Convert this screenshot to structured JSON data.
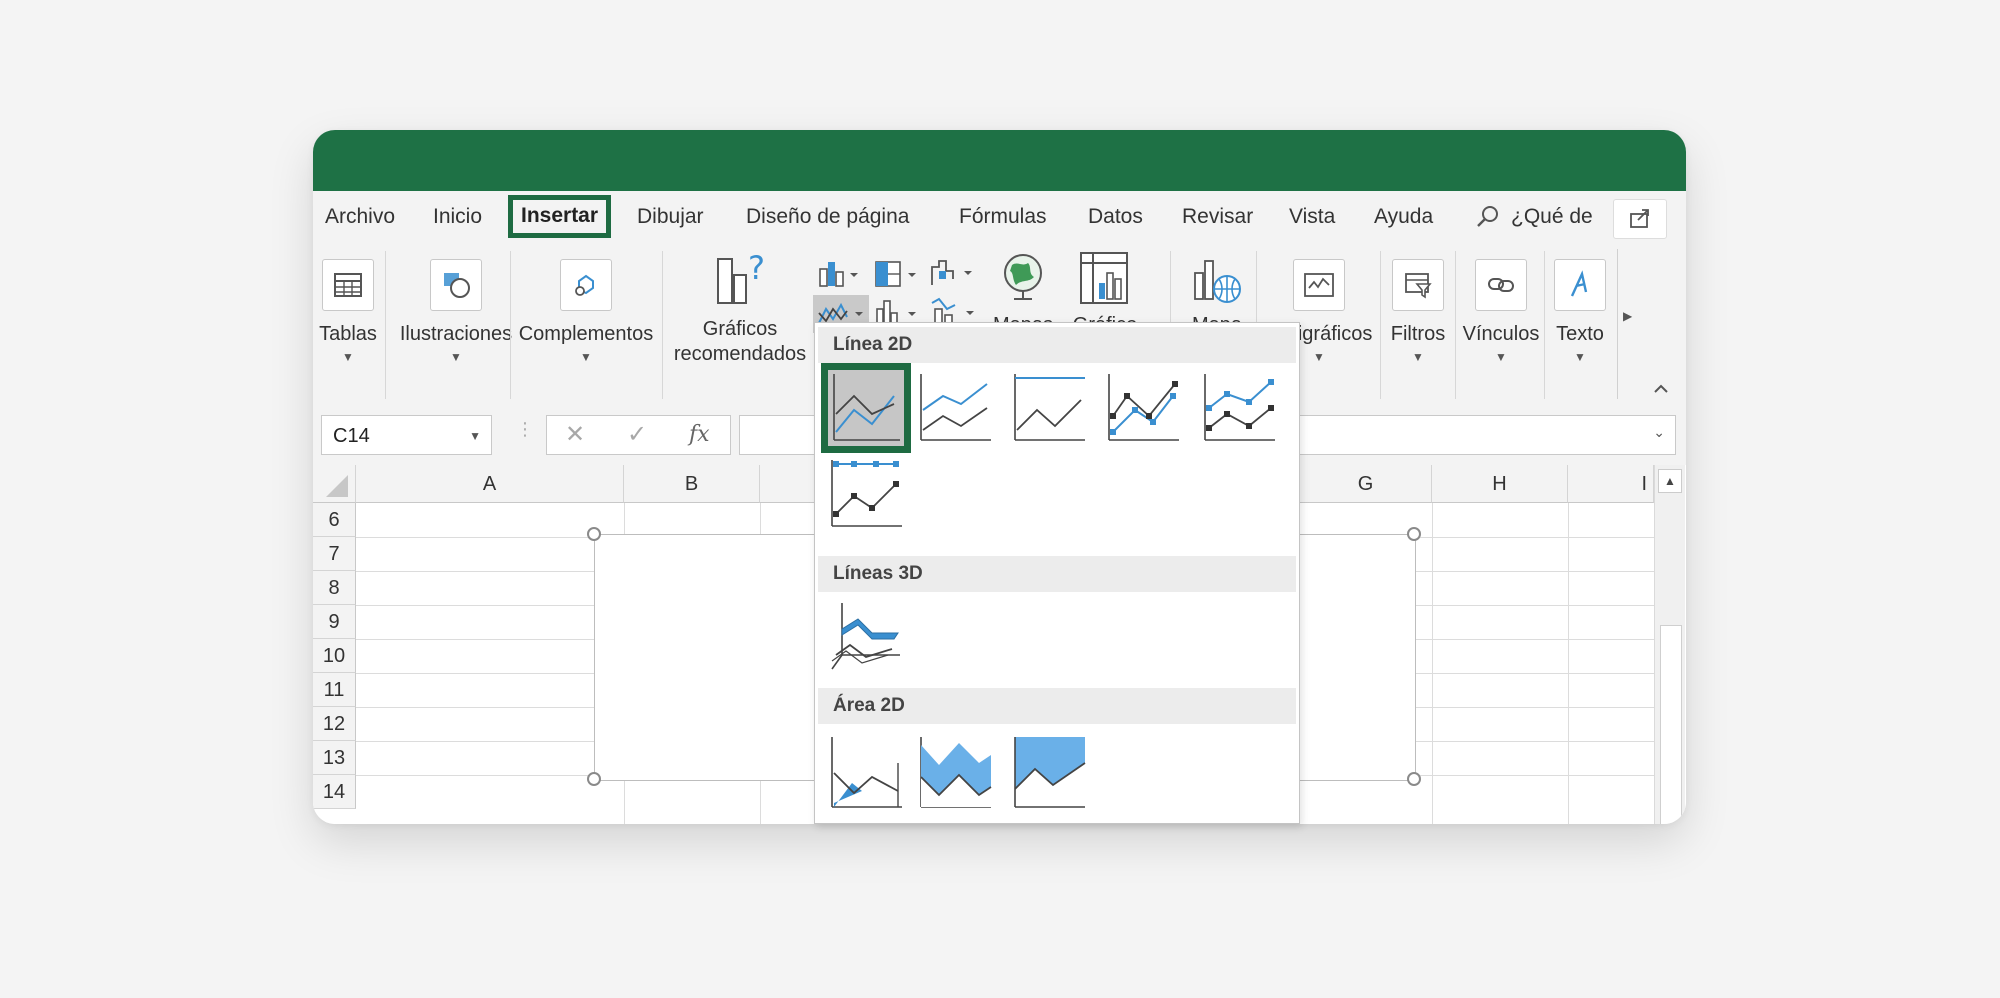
{
  "menubar": {
    "tabs": [
      "Archivo",
      "Inicio",
      "Insertar",
      "Dibujar",
      "Diseño de página",
      "Fórmulas",
      "Datos",
      "Revisar",
      "Vista",
      "Ayuda"
    ],
    "active_tab": "Insertar",
    "search_text": "¿Qué de"
  },
  "ribbon": {
    "tablas": "Tablas",
    "ilustraciones": "Ilustraciones",
    "complementos": "Complementos",
    "graficos_line1": "Gráficos",
    "graficos_line2": "recomendados",
    "mapas": "Mapas",
    "grafico_dinamico": "Gráfico",
    "mapa_3d": "Mapa",
    "minigraficos": "Minigráficos",
    "filtros": "Filtros",
    "vinculos": "Vínculos",
    "texto": "Texto"
  },
  "formula_bar": {
    "name_box": "C14",
    "fx_label": "fx"
  },
  "sheet": {
    "columns": [
      "A",
      "B",
      "G",
      "H",
      "I"
    ],
    "rows": [
      "6",
      "7",
      "8",
      "9",
      "10",
      "11",
      "12",
      "13",
      "14"
    ]
  },
  "dropdown": {
    "section_line2d": "Línea 2D",
    "section_line3d": "Líneas 3D",
    "section_area2d": "Área 2D"
  },
  "colors": {
    "brand_green": "#1e7145",
    "highlight_green": "#1e6b42",
    "chart_blue": "#3a8fd0",
    "area_blue": "#6ab0e8"
  }
}
